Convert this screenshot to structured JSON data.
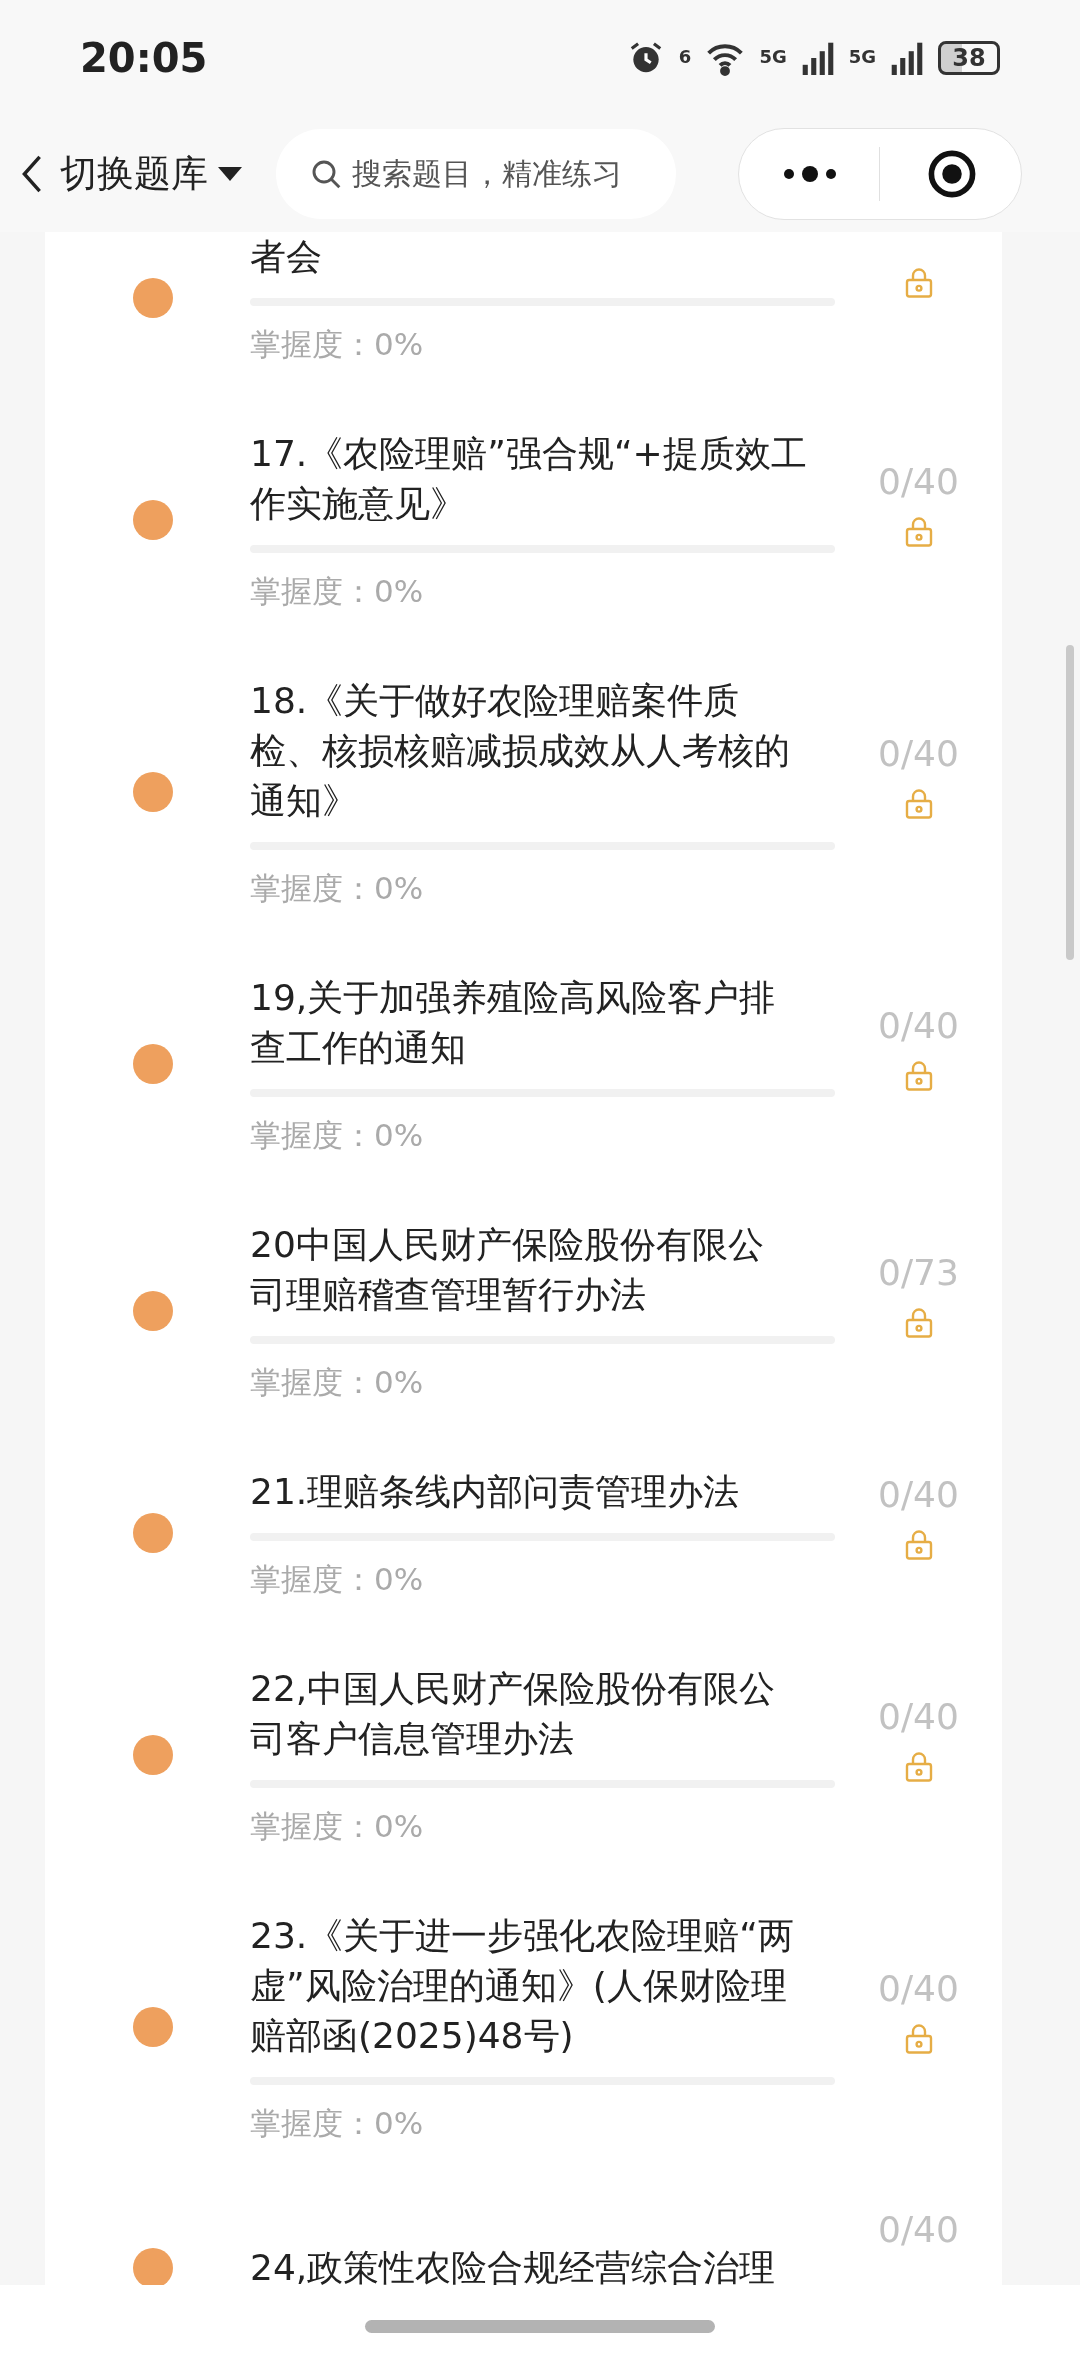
{
  "status_bar": {
    "time": "20:05",
    "wifi_label": "6",
    "sim1": "5G",
    "sim2": "5G",
    "battery": "38"
  },
  "nav": {
    "title": "切换题库",
    "search": {
      "placeholder": "搜索题目，精准练习"
    }
  },
  "items": [
    {
      "title_lines": [
        "者会"
      ],
      "mastery": "掌握度：0%",
      "locked": true
    },
    {
      "title_lines": [
        "17.《农险理赔”强合规“+提质效工",
        "作实施意见》"
      ],
      "count": "0/40",
      "mastery": "掌握度：0%",
      "locked": true
    },
    {
      "title_lines": [
        "18.《关于做好农险理赔案件质",
        "检、核损核赔减损成效从人考核的",
        "通知》"
      ],
      "count": "0/40",
      "mastery": "掌握度：0%",
      "locked": true
    },
    {
      "title_lines": [
        "19,关于加强养殖险高风险客户排",
        "查工作的通知"
      ],
      "count": "0/40",
      "mastery": "掌握度：0%",
      "locked": true
    },
    {
      "title_lines": [
        "20中国人民财产保险股份有限公",
        "司理赔稽查管理暂行办法"
      ],
      "count": "0/73",
      "mastery": "掌握度：0%",
      "locked": true
    },
    {
      "title_lines": [
        "21.理赔条线内部问责管理办法"
      ],
      "count": "0/40",
      "mastery": "掌握度：0%",
      "locked": true
    },
    {
      "title_lines": [
        "22,中国人民财产保险股份有限公",
        "司客户信息管理办法"
      ],
      "count": "0/40",
      "mastery": "掌握度：0%",
      "locked": true
    },
    {
      "title_lines": [
        "23.《关于进一步强化农险理赔“两",
        "虚”风险治理的通知》(人保财险理",
        "赔部函(2025)48号)"
      ],
      "count": "0/40",
      "mastery": "掌握度：0%",
      "locked": true
    },
    {
      "title_lines": [
        "24,政策性农险合规经营综合治理"
      ],
      "count": "0/40"
    }
  ]
}
